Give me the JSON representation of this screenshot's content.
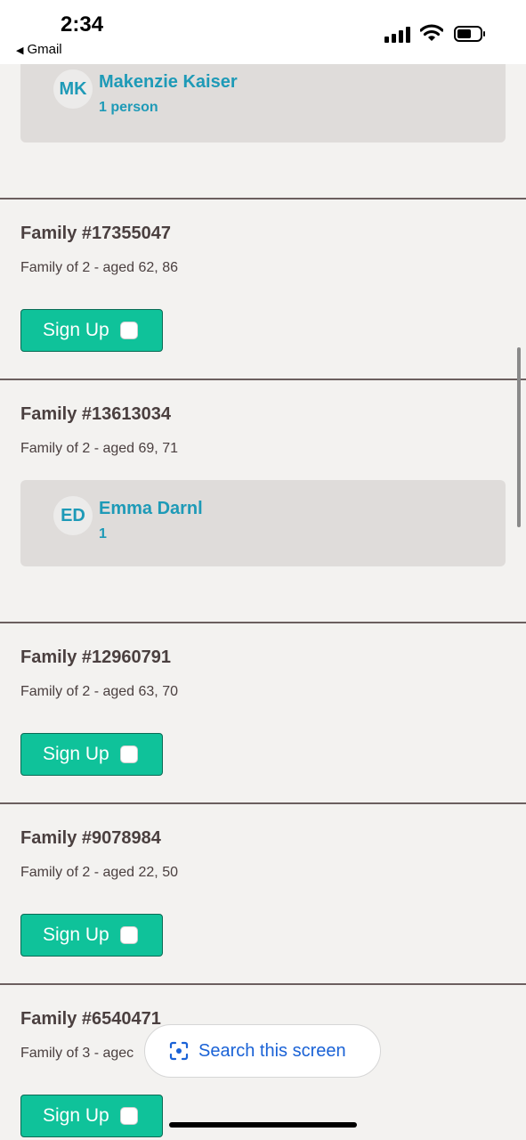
{
  "status_bar": {
    "time": "2:34",
    "back_label": "Gmail"
  },
  "families": [
    {
      "volunteer": {
        "initials": "MK",
        "name": "Makenzie Kaiser",
        "count": "1 person"
      }
    },
    {
      "title": "Family #17355047",
      "description": "Family of 2 - aged 62, 86",
      "signup_label": "Sign Up"
    },
    {
      "title": "Family #13613034",
      "description": "Family of 2 - aged 69, 71",
      "volunteer": {
        "initials": "ED",
        "name": "Emma Darnl",
        "count": "1"
      }
    },
    {
      "title": "Family #12960791",
      "description": "Family of 2 - aged 63, 70",
      "signup_label": "Sign Up"
    },
    {
      "title": "Family #9078984",
      "description": "Family of 2 - aged 22, 50",
      "signup_label": "Sign Up"
    },
    {
      "title": "Family #6540471",
      "description": "Family of 3 - agec",
      "signup_label": "Sign Up"
    }
  ],
  "search_overlay": {
    "label": "Search this screen"
  },
  "colors": {
    "accent": "#0fc29a",
    "link": "#1e9ab7",
    "panel": "#dfdcda"
  }
}
